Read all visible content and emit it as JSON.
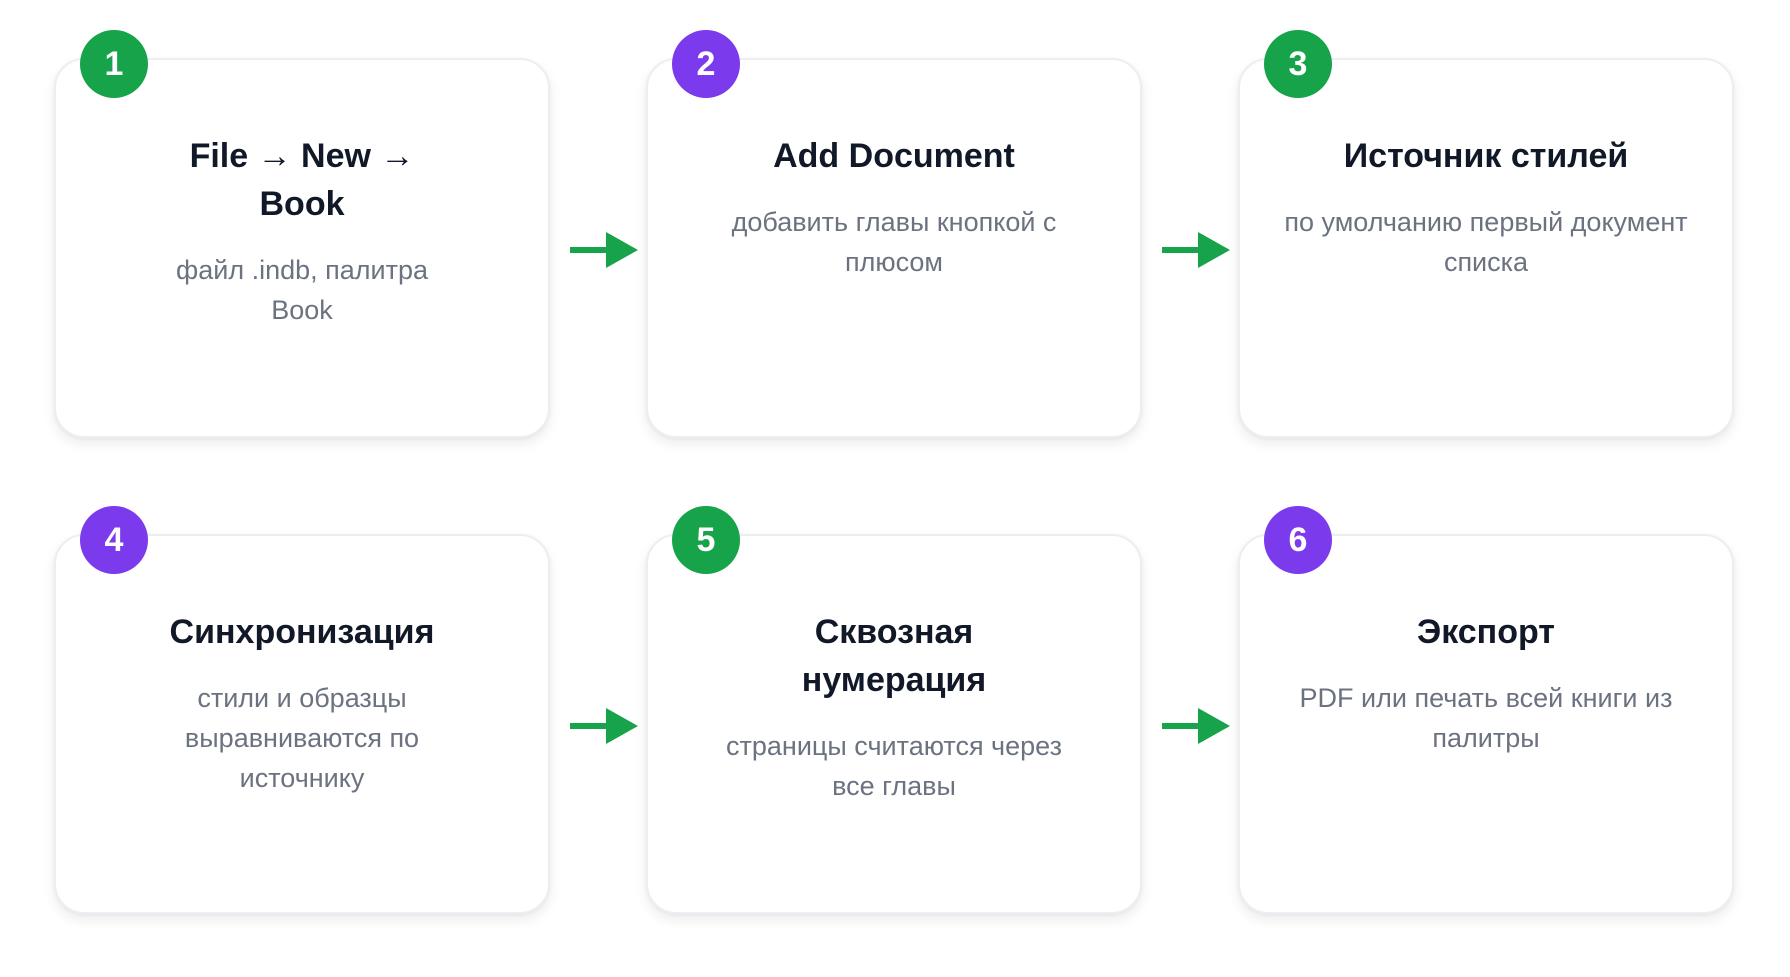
{
  "diagram": {
    "accent_green": "#16a34a",
    "accent_purple": "#7c3aed",
    "steps": [
      {
        "number": "1",
        "title": "File → New → Book",
        "description": "файл .indb, палитра Book",
        "badge_color": "#16a34a"
      },
      {
        "number": "2",
        "title": "Add Document",
        "description": "добавить главы кнопкой с плюсом",
        "badge_color": "#7c3aed"
      },
      {
        "number": "3",
        "title": "Источник стилей",
        "description": "по умолчанию первый документ списка",
        "badge_color": "#16a34a"
      },
      {
        "number": "4",
        "title": "Синхронизация",
        "description": "стили и образцы выравниваются по источнику",
        "badge_color": "#7c3aed"
      },
      {
        "number": "5",
        "title": "Сквозная нумерация",
        "description": "страницы считаются через все главы",
        "badge_color": "#16a34a"
      },
      {
        "number": "6",
        "title": "Экспорт",
        "description": "PDF или печать всей книги из палитры",
        "badge_color": "#7c3aed"
      }
    ]
  }
}
